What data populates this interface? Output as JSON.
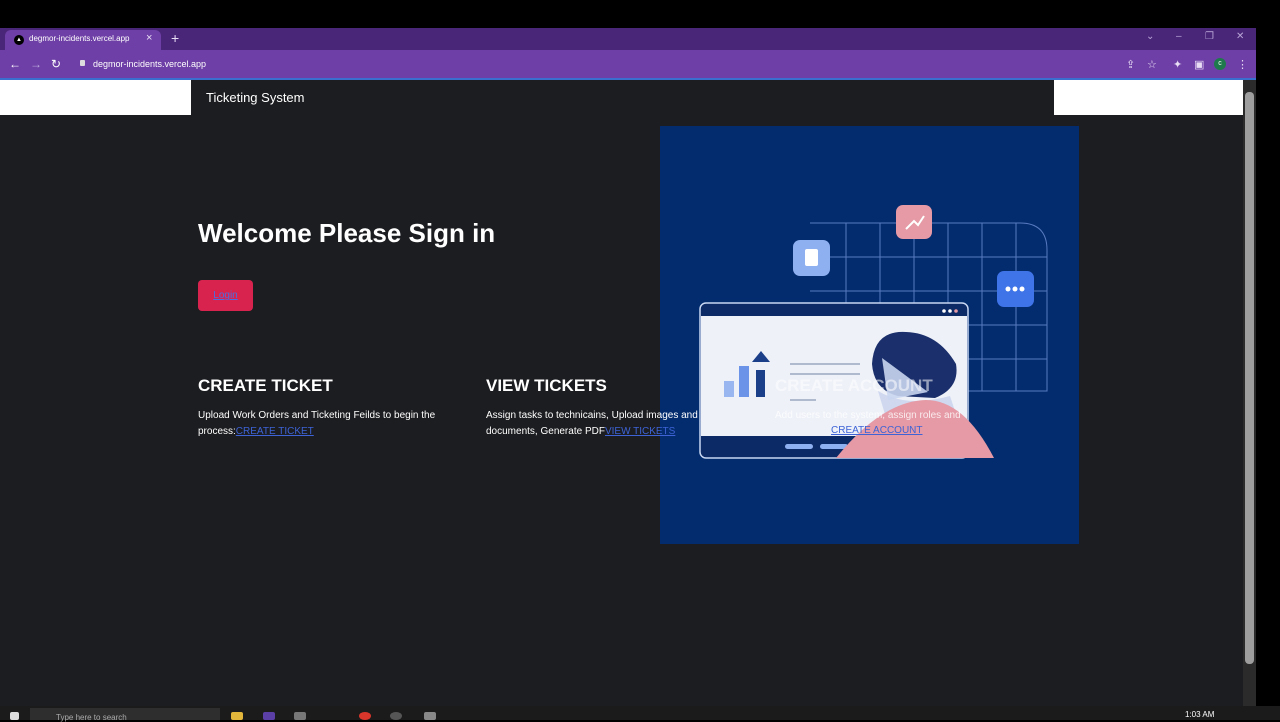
{
  "browser": {
    "tab_title": "degmor-incidents.vercel.app",
    "tab_close": "×",
    "new_tab": "+",
    "url": "degmor-incidents.vercel.app",
    "profile_initial": "c"
  },
  "navbar": {
    "brand": "Ticketing System"
  },
  "hero": {
    "title": "Welcome Please Sign in",
    "login_label": "Login"
  },
  "cards": [
    {
      "title": "CREATE TICKET",
      "line1": "Upload Work Orders and Ticketing Feilds to begin the",
      "line2": "process:",
      "link": "CREATE TICKET"
    },
    {
      "title": "VIEW TICKETS",
      "line1": "Assign tasks to technicains, Upload images and",
      "line2": "documents, Generate PDF",
      "link": "VIEW TICKETS"
    },
    {
      "title": "CREATE ACCOUNT",
      "line1": "Add users to the system, assign roles and",
      "link": "CREATE ACCOUNT"
    }
  ],
  "taskbar": {
    "search_placeholder": "Type here to search",
    "clock": "1:03 AM"
  },
  "colors": {
    "chrome": "#6e3fa6",
    "page_bg": "#1c1d20",
    "login_button": "#d9234f",
    "illustration_bg": "#032c6e",
    "link": "#3d63d6"
  }
}
